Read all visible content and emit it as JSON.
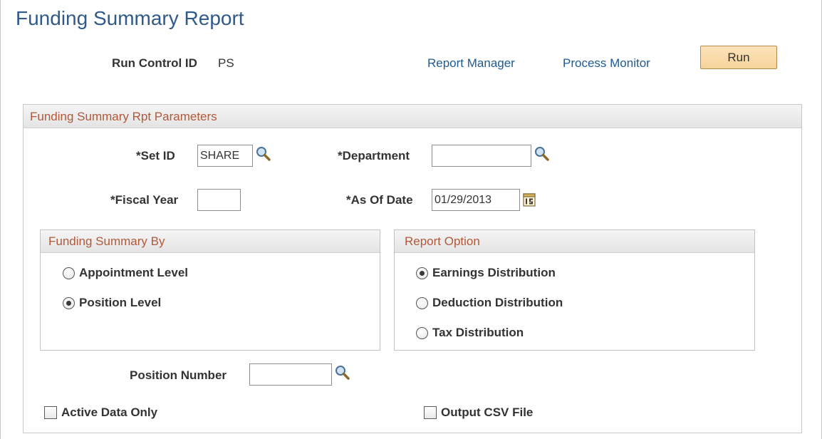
{
  "page": {
    "title": "Funding Summary Report"
  },
  "run_control": {
    "label": "Run Control ID",
    "value": "PS"
  },
  "links": {
    "report_manager": "Report Manager",
    "process_monitor": "Process Monitor"
  },
  "run_button": {
    "label": "Run"
  },
  "parameters": {
    "section_title": "Funding Summary Rpt Parameters",
    "set_id": {
      "label": "*Set ID",
      "value": "SHARE"
    },
    "department": {
      "label": "*Department",
      "value": ""
    },
    "fiscal_year": {
      "label": "*Fiscal Year",
      "value": ""
    },
    "as_of_date": {
      "label": "*As Of Date",
      "value": "01/29/2013"
    },
    "funding_summary_by": {
      "title": "Funding Summary By",
      "options": [
        {
          "label": "Appointment Level",
          "checked": false
        },
        {
          "label": "Position Level",
          "checked": true
        }
      ]
    },
    "report_option": {
      "title": "Report Option",
      "options": [
        {
          "label": "Earnings Distribution",
          "checked": true
        },
        {
          "label": "Deduction Distribution",
          "checked": false
        },
        {
          "label": "Tax Distribution",
          "checked": false
        }
      ]
    },
    "position_number": {
      "label": "Position Number",
      "value": ""
    },
    "active_data_only": {
      "label": "Active Data Only",
      "checked": false
    },
    "output_csv": {
      "label": "Output CSV File",
      "checked": false
    }
  },
  "icons": {
    "lookup": "magnifying-glass-icon",
    "calendar": "calendar-icon"
  },
  "colors": {
    "title": "#2f5a8a",
    "link": "#1f5a93",
    "section_title": "#b0593a",
    "run_button": "#f7d39a"
  }
}
